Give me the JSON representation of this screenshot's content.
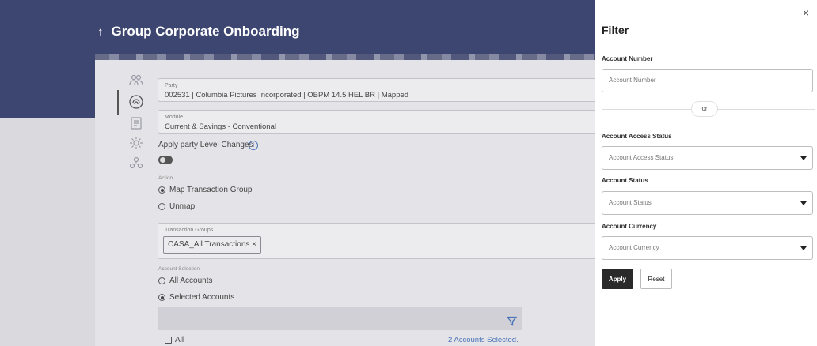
{
  "page": {
    "title": "Group Corporate Onboarding",
    "back_icon": "up-arrow-icon"
  },
  "form": {
    "party_label": "Party",
    "party_value": "002531 | Columbia Pictures Incorporated | OBPM 14.5 HEL BR | Mapped",
    "module_label": "Module",
    "module_value": "Current & Savings - Conventional",
    "apply_party_level_label": "Apply party Level Changes",
    "action_label": "Action",
    "action_options": [
      "Map Transaction Group",
      "Unmap"
    ],
    "action_selected": "Map Transaction Group",
    "transaction_groups_label": "Transaction Groups",
    "transaction_group_chip": "CASA_All Transactions ×",
    "account_selection_label": "Account Selection",
    "account_selection_options": [
      "All Accounts",
      "Selected Accounts"
    ],
    "account_selection_selected": "Selected Accounts",
    "table_all_label": "All",
    "accounts_selected_text": "2 Accounts Selected."
  },
  "filter": {
    "title": "Filter",
    "close_glyph": "×",
    "account_number_label": "Account Number",
    "account_number_placeholder": "Account Number",
    "or_text": "or",
    "account_access_status_label": "Account Access Status",
    "account_access_status_placeholder": "Account Access Status",
    "account_status_label": "Account Status",
    "account_status_placeholder": "Account Status",
    "account_currency_label": "Account Currency",
    "account_currency_placeholder": "Account Currency",
    "apply_label": "Apply",
    "reset_label": "Reset"
  },
  "colors": {
    "banner": "#3d4670",
    "accent_blue": "#4b73b7",
    "primary_button": "#2a2a2a"
  }
}
